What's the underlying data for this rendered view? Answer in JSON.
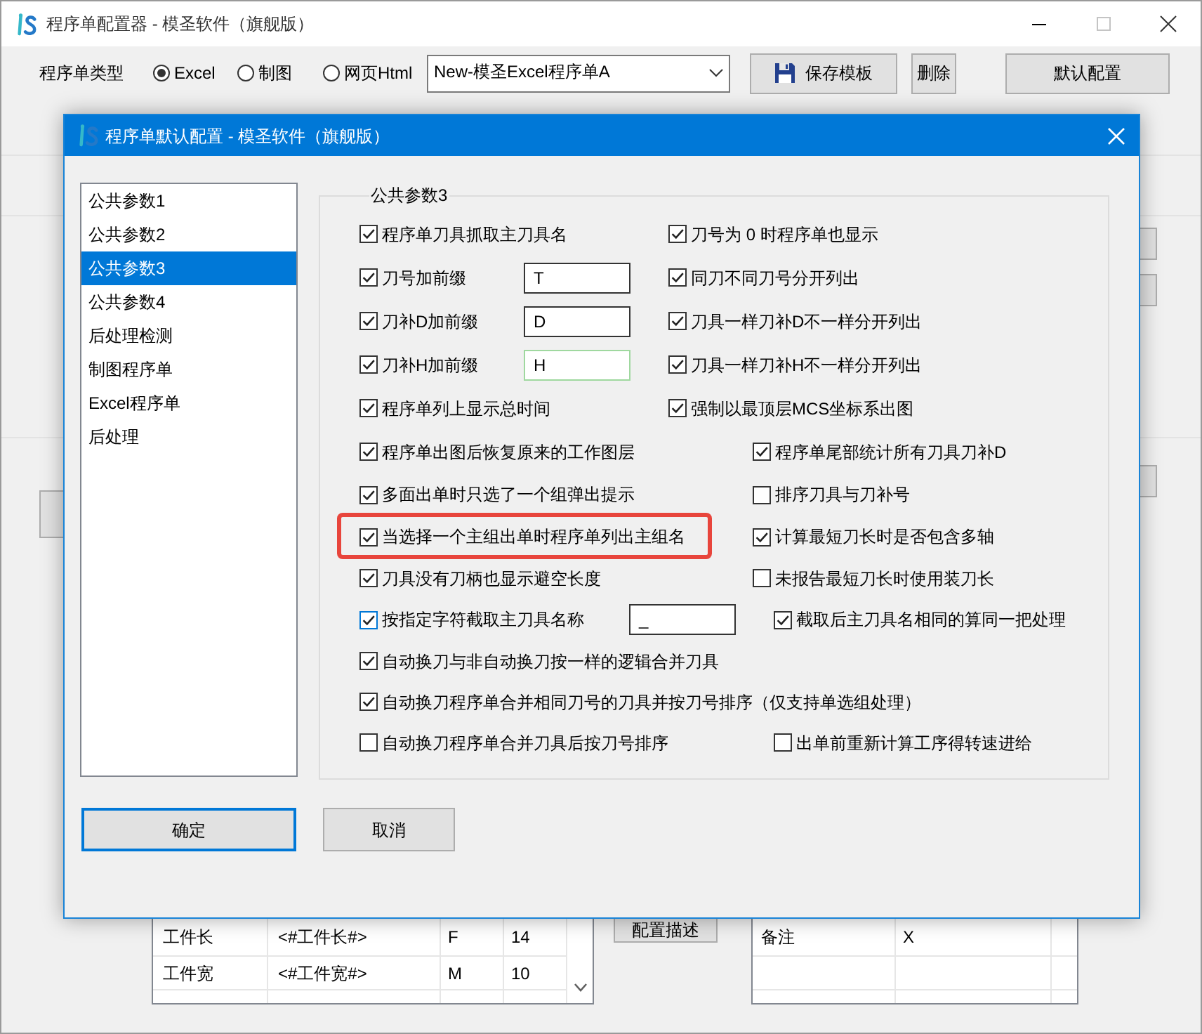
{
  "window": {
    "title": "程序单配置器 - 模圣软件（旗舰版）"
  },
  "toolbar": {
    "type_label": "程序单类型",
    "radios": [
      {
        "label": "Excel",
        "selected": true
      },
      {
        "label": "制图",
        "selected": false
      },
      {
        "label": "网页Html",
        "selected": false
      }
    ],
    "template": {
      "value": "New-模圣Excel程序单A"
    },
    "buttons": [
      {
        "kind": "save",
        "label": "保存模板"
      },
      {
        "kind": "plain",
        "label": "删除"
      },
      {
        "kind": "plain",
        "label": "默认配置"
      }
    ]
  },
  "dialog": {
    "title": "程序单默认配置 - 模圣软件（旗舰版）",
    "nav": [
      {
        "label": "公共参数1",
        "selected": false
      },
      {
        "label": "公共参数2",
        "selected": false
      },
      {
        "label": "公共参数3",
        "selected": true
      },
      {
        "label": "公共参数4",
        "selected": false
      },
      {
        "label": "后处理检测",
        "selected": false
      },
      {
        "label": "制图程序单",
        "selected": false
      },
      {
        "label": "Excel程序单",
        "selected": false
      },
      {
        "label": "后处理",
        "selected": false
      }
    ],
    "group": {
      "title": "公共参数3",
      "rows": [
        {
          "left": {
            "label": "程序单刀具抓取主刀具名",
            "checked": true,
            "focused": false,
            "highlighted": false
          },
          "right": {
            "label": "刀号为 0 时程序单也显示",
            "checked": true
          }
        },
        {
          "left": {
            "label": "刀号加前缀",
            "checked": true,
            "focused": false,
            "highlighted": false
          },
          "input": {
            "value": "T",
            "highlighted": false
          },
          "right": {
            "label": "同刀不同刀号分开列出",
            "checked": true
          }
        },
        {
          "left": {
            "label": "刀补D加前缀",
            "checked": true,
            "focused": false,
            "highlighted": false
          },
          "input": {
            "value": "D",
            "highlighted": false
          },
          "right": {
            "label": "刀具一样刀补D不一样分开列出",
            "checked": true
          }
        },
        {
          "left": {
            "label": "刀补H加前缀",
            "checked": true,
            "focused": false,
            "highlighted": false
          },
          "input": {
            "value": "H",
            "highlighted": true
          },
          "right": {
            "label": "刀具一样刀补H不一样分开列出",
            "checked": true
          }
        },
        {
          "left": {
            "label": "程序单列上显示总时间",
            "checked": true,
            "focused": false,
            "highlighted": false
          },
          "right": {
            "label": "强制以最顶层MCS坐标系出图",
            "checked": true
          }
        },
        {
          "left": {
            "label": "程序单出图后恢复原来的工作图层",
            "checked": true,
            "focused": false,
            "highlighted": false
          },
          "right": {
            "label": "程序单尾部统计所有刀具刀补D",
            "checked": true
          }
        },
        {
          "left": {
            "label": "多面出单时只选了一个组弹出提示",
            "checked": true,
            "focused": false,
            "highlighted": false
          },
          "right": {
            "label": "排序刀具与刀补号",
            "checked": false
          }
        },
        {
          "left": {
            "label": "当选择一个主组出单时程序单列出主组名",
            "checked": true,
            "focused": false,
            "highlighted": true
          },
          "right": {
            "label": "计算最短刀长时是否包含多轴",
            "checked": true
          }
        },
        {
          "left": {
            "label": "刀具没有刀柄也显示避空长度",
            "checked": true,
            "focused": false,
            "highlighted": false
          },
          "right": {
            "label": "未报告最短刀长时使用装刀长",
            "checked": false
          }
        },
        {
          "left": {
            "label": "按指定字符截取主刀具名称",
            "checked": true,
            "focused": true,
            "highlighted": false
          },
          "input": {
            "value": "_",
            "highlighted": false
          },
          "right": {
            "label": "截取后主刀具名相同的算同一把处理",
            "checked": true
          }
        },
        {
          "left": {
            "label": "自动换刀与非自动换刀按一样的逻辑合并刀具",
            "checked": true,
            "focused": false,
            "highlighted": false
          }
        },
        {
          "left": {
            "label": "自动换刀程序单合并相同刀号的刀具并按刀号排序（仅支持单选组处理）",
            "checked": true,
            "focused": false,
            "highlighted": false
          }
        },
        {
          "left": {
            "label": "自动换刀程序单合并刀具后按刀号排序",
            "checked": false,
            "focused": false,
            "highlighted": false
          },
          "right": {
            "label": "出单前重新计算工序得转速进给",
            "checked": false
          }
        }
      ]
    },
    "buttons": [
      {
        "label": "确定",
        "default": true
      },
      {
        "label": "取消",
        "default": false
      }
    ]
  },
  "background": {
    "parameter_table": {
      "rows": [
        {
          "cells": [
            "工件长",
            "<#工件长#>",
            "F",
            "14"
          ]
        },
        {
          "cells": [
            "工件宽",
            "<#工件宽#>",
            "M",
            "10"
          ]
        }
      ]
    },
    "describe_button": {
      "label": "配置描述"
    },
    "note_table": {
      "rows": [
        {
          "cells": [
            "备注",
            "X"
          ]
        }
      ]
    }
  }
}
